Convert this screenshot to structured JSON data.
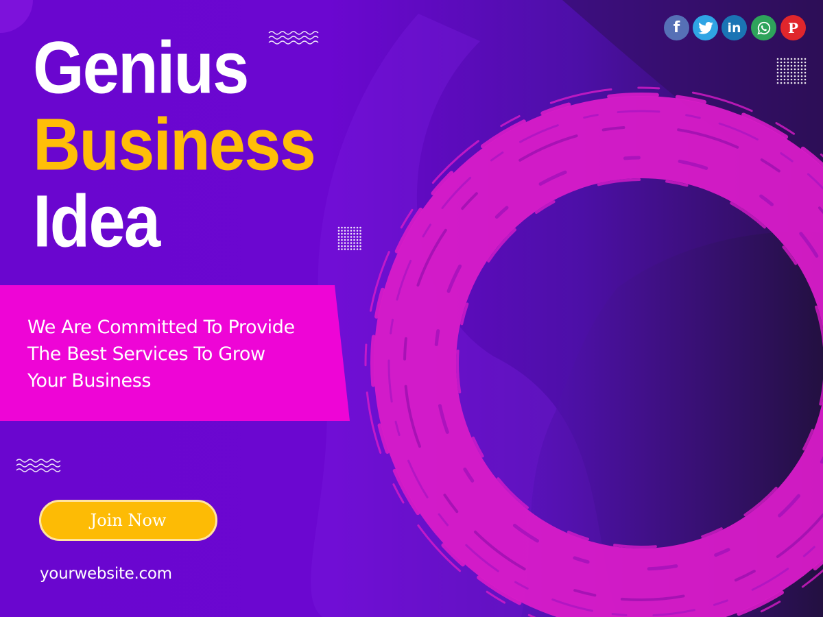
{
  "headline": {
    "line1": "Genius",
    "line2": "Business",
    "line3": "Idea"
  },
  "tagline": {
    "line1": "We Are Committed To Provide",
    "line2": "The Best Services To Grow",
    "line3": "Your Business"
  },
  "cta": {
    "label": "Join Now"
  },
  "website": "yourwebsite.com",
  "social": {
    "facebook": "f",
    "linkedin": "in",
    "pinterest": "P",
    "icons": [
      "facebook-icon",
      "twitter-icon",
      "linkedin-icon",
      "whatsapp-icon",
      "pinterest-icon"
    ]
  },
  "colors": {
    "background": "#6a06cf",
    "accent_magenta": "#ee05d6",
    "accent_yellow": "#ffbe08",
    "brush_ring": "#d81cc8",
    "text": "#ffffff"
  }
}
